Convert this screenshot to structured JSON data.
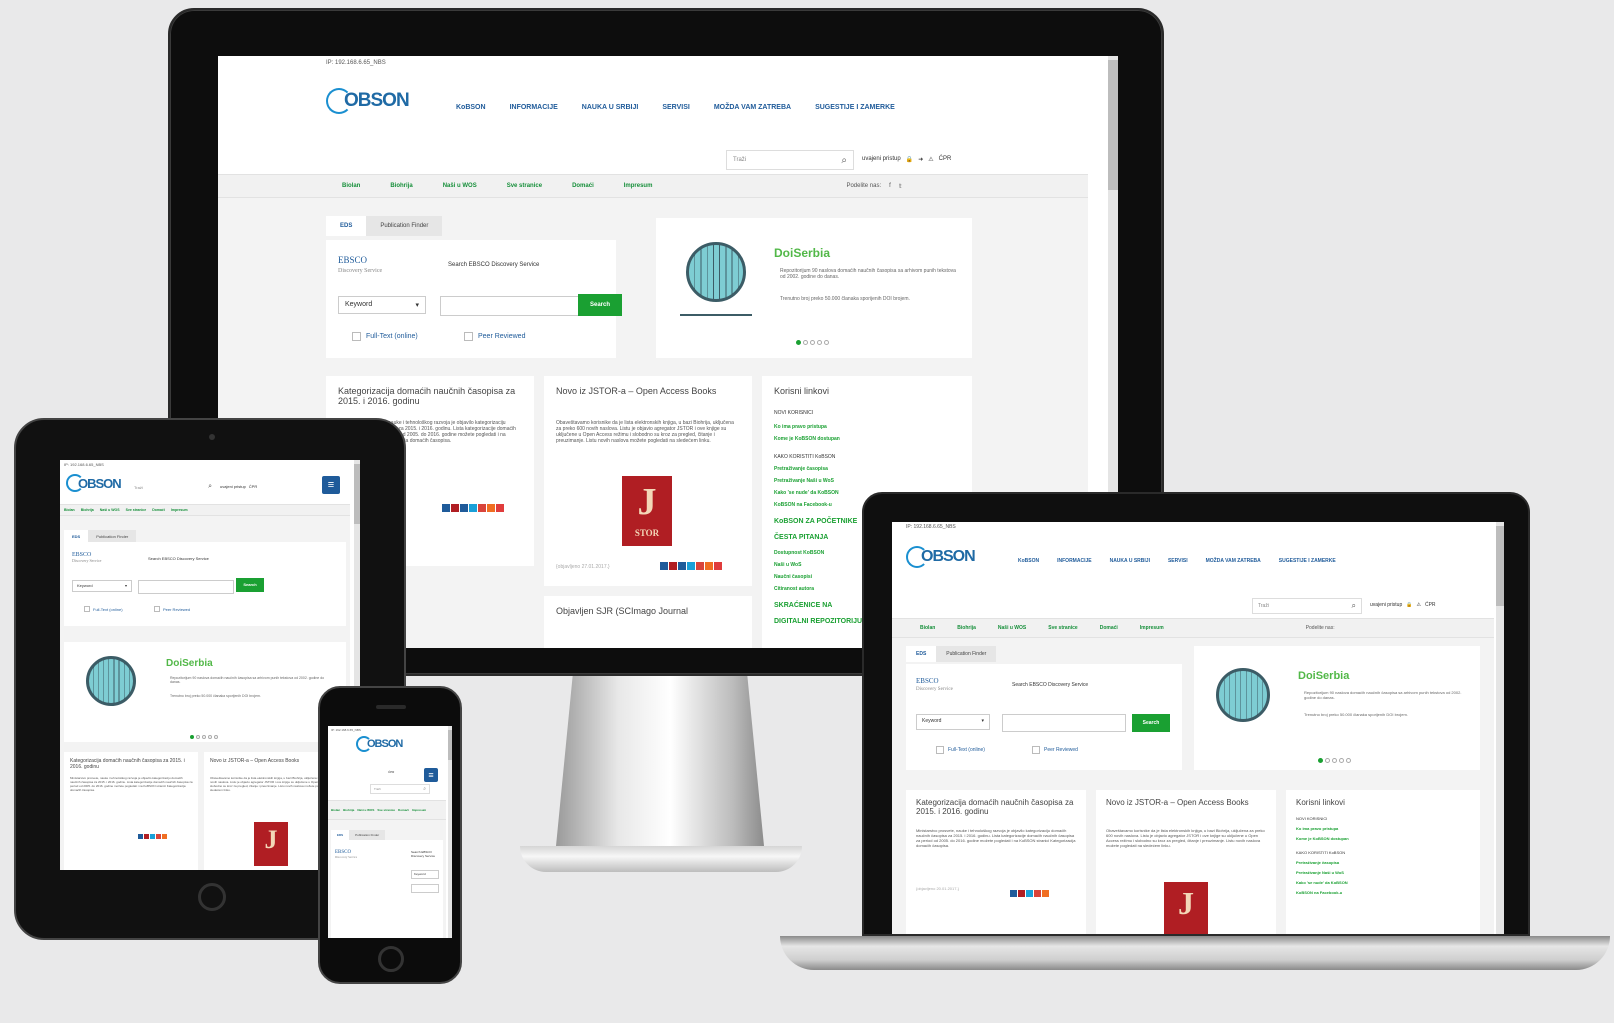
{
  "site": {
    "ip_label": "IP: 192.168.6.65_NBS",
    "logo_text": "OBSON",
    "logo_letter": "K",
    "nav": [
      "KoBSON",
      "INFORMACIJE",
      "NAUKA U SRBIJI",
      "SERVISI",
      "MOŽDA VAM ZATREBA",
      "SUGESTIJE I ZAMERKE"
    ],
    "search_placeholder": "Traži",
    "user_links": "uvajeni pristup",
    "cir_label": "ĆPR",
    "subnav": [
      "Biolan",
      "Biohrija",
      "Naši u WOS",
      "Sve stranice",
      "Domaći",
      "Impresum"
    ],
    "share_label": "Podelite nas:",
    "tabs": [
      "EDS",
      "Publication Finder"
    ],
    "ebsco_brand": "EBSCO",
    "ebsco_sub": "Discovery Service",
    "ebsco_search_label": "Search EBSCO Discovery Service",
    "keyword_option": "Keyword",
    "search_button": "Search",
    "fulltext_label": "Full-Text (online)",
    "peer_label": "Peer Reviewed",
    "doi_title": "DoiSerbia",
    "doi_bullets": [
      "Repozitorijum 90 naslova domaćih naučnih časopisa sa arhivom punih tekstova od 2002. godine do danas.",
      "Trenutno broj preko 50.000 članaka sporijenih DOI brojem."
    ],
    "news1_title": "Kategorizacija domaćih naučnih časopisa za 2015. i 2016. godinu",
    "news1_body": "Ministarstvo prosvete, nauke i tehnološkog razvoja je objavilo kategorizaciju domaćih naučnih časopisa za 2015. i 2016. godinu. Lista kategorizacije domaćih naučnih časopisa za period od 2005. do 2016. godine možete pogledati i na KoBSON stranici Kategorizacija domaćih časopisa.",
    "news1_date": "{objavljeno 20.01.2017.}",
    "news2_title": "Novo iz JSTOR-a – Open Access Books",
    "news2_body": "Obaveštavamo korisnike da je lista elektronskih knjiga, u bazi Biohrija, uključena za preko 600 novih naslova. Listu je objavio agregator JSTOR i ove knjige su uključene u Open Access režimu i slobodno su kroz za pregled, čitanje i preuzimanje. Listu novih naslova možete pogledati na sledećem linku.",
    "news2_date": "{objavljeno 27.01.2017.}",
    "news3_title": "Objavljen SJR (SCImago Journal",
    "jstor_letter": "J",
    "jstor_word": "STOR",
    "links_title": "Korisni linkovi",
    "links_new_users": "NOVI KORISNICI",
    "links_new": [
      "Ko ima pravo pristupa",
      "Kome je KoBSON dostupan"
    ],
    "links_how": "KAKO KORISTITI KoBSON",
    "links_how_items": [
      "Pretraživanje časopisa",
      "Pretraživanje Naši u WoS",
      "Kako 'se nude' da KoBSON",
      "KoBSON na Facebook-u"
    ],
    "links_more": [
      "KoBSON ZA POČETNIKE",
      "ČESTA PITANJA",
      "Dostupnost KoBSON",
      "Naši u WoS",
      "Naučni časopisi",
      "Citiranost autora",
      "SKRAĆENICE NA",
      "DIGITALNI REPOZITORIJUM"
    ],
    "tablet_news1_title": "Kategorizacija domaćih naučnih časopisa za 2015. i 2016. godinu",
    "tablet_news2_title": "Novo iz JSTOR-a – Open Access Books",
    "tablet_peek1": "ova",
    "tablet_peek2": "korisnike da je lista u bazi Royal Society of Chemistry je uključena preko 600 novih naslova"
  },
  "colors": {
    "brand_green": "#1aa032",
    "brand_blue": "#1f5b9a",
    "doi_green": "#52b848",
    "jstor_red": "#b01e23"
  },
  "icons": [
    "search-icon",
    "lock-icon",
    "login-icon",
    "sitemap-icon",
    "facebook-icon",
    "twitter-icon",
    "globe-icon",
    "hamburger-icon",
    "chevron-down-icon",
    "share-icons"
  ]
}
